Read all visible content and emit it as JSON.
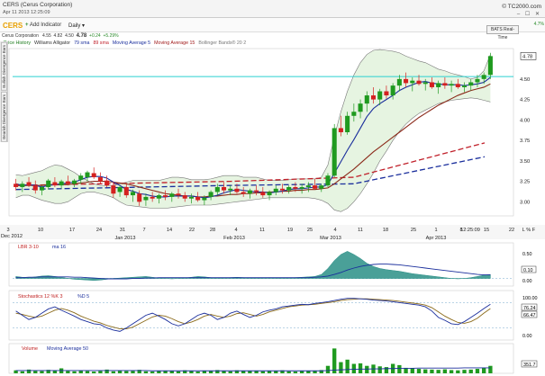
{
  "window": {
    "title": "CERS (Cerus Corporation)",
    "timestamp": "Apr 11 2013 12:25:09",
    "brand": "© TC2000.com",
    "controls": "– ☐ ✕"
  },
  "toolbar": {
    "symbol": "CERS",
    "add_indicator": "Add Indicator",
    "period": "Daily",
    "period_arrow": "▾"
  },
  "quote": {
    "name": "Cerus Corporation",
    "open": "4.55",
    "high": "4.82",
    "low": "4.50",
    "last": "4.78",
    "change": "+0.24",
    "pct": "+5.29%",
    "realtime": "BATS Real-Time",
    "side_pct": "4.7%"
  },
  "legend": [
    {
      "label": "Price History",
      "color": "#1a7a1a"
    },
    {
      "label": "Williams Alligator",
      "color": "#333333"
    },
    {
      "label": "79 sma",
      "color": "#1a2e9c"
    },
    {
      "label": "89 sma",
      "color": "#c0202a"
    },
    {
      "label": "Moving Average 5",
      "color": "#1a2e9c"
    },
    {
      "label": "Moving Average 15",
      "color": "#a01818"
    },
    {
      "label": "Bollinger Bands® 20 2",
      "color": "#777777"
    }
  ],
  "side_tabs": [
    "Bullish Divergence Bars",
    "Bearish Divergence Bars"
  ],
  "price_axis": {
    "ticks": [
      "4.50",
      "4.25",
      "4.00",
      "3.75",
      "3.50",
      "3.25",
      "3.00"
    ],
    "last_flag": "4.78"
  },
  "date_axis": {
    "corner": "Dec 2012",
    "day_ticks": [
      "3",
      "10",
      "17",
      "24",
      "31",
      "7",
      "14",
      "22",
      "28",
      "4",
      "11",
      "19",
      "25",
      "4",
      "11",
      "18",
      "25",
      "1",
      "8",
      "15",
      "22"
    ],
    "month_ticks": [
      "Jan 2013",
      "Feb 2013",
      "Mar 2013",
      "Apr 2013"
    ],
    "time_label": "12:25:09",
    "scale_label": "L % F"
  },
  "panels": {
    "lbr": {
      "label": "LBR 3-10",
      "ma": "ma 16",
      "ticks": [
        "0.50",
        "0.00"
      ],
      "flag": "0.10"
    },
    "stoch": {
      "label": "Stochastics 12 %K 3",
      "d": "%D 5",
      "ticks": [
        "100.00",
        "50.00",
        "0.00"
      ],
      "flags": [
        "76.24",
        "66.47"
      ]
    },
    "volume": {
      "label": "Volume",
      "ma": "Moving Average 50",
      "flag": "351.7"
    }
  },
  "chart_data": {
    "type": "candlestick",
    "ylim": [
      2.85,
      4.85
    ],
    "ref_line": 4.53,
    "ohlc": [
      [
        3.22,
        3.28,
        3.14,
        3.18
      ],
      [
        3.18,
        3.25,
        3.12,
        3.22
      ],
      [
        3.24,
        3.3,
        3.18,
        3.2
      ],
      [
        3.2,
        3.26,
        3.1,
        3.14
      ],
      [
        3.14,
        3.2,
        3.08,
        3.18
      ],
      [
        3.18,
        3.28,
        3.15,
        3.26
      ],
      [
        3.24,
        3.3,
        3.18,
        3.2
      ],
      [
        3.2,
        3.27,
        3.16,
        3.25
      ],
      [
        3.25,
        3.32,
        3.2,
        3.22
      ],
      [
        3.22,
        3.28,
        3.18,
        3.26
      ],
      [
        3.27,
        3.35,
        3.22,
        3.32
      ],
      [
        3.3,
        3.38,
        3.25,
        3.36
      ],
      [
        3.35,
        3.42,
        3.28,
        3.3
      ],
      [
        3.3,
        3.36,
        3.22,
        3.25
      ],
      [
        3.26,
        3.32,
        3.18,
        3.2
      ],
      [
        3.2,
        3.25,
        3.05,
        3.1
      ],
      [
        3.12,
        3.2,
        3.06,
        3.18
      ],
      [
        3.18,
        3.22,
        3.05,
        3.08
      ],
      [
        3.08,
        3.15,
        3.0,
        3.12
      ],
      [
        3.1,
        3.14,
        2.95,
        3.0
      ],
      [
        3.02,
        3.1,
        2.95,
        3.06
      ],
      [
        3.06,
        3.12,
        3.0,
        3.04
      ],
      [
        3.04,
        3.1,
        2.98,
        3.08
      ],
      [
        3.08,
        3.14,
        3.02,
        3.06
      ],
      [
        3.06,
        3.12,
        3.0,
        3.1
      ],
      [
        3.1,
        3.16,
        3.04,
        3.08
      ],
      [
        3.08,
        3.12,
        3.0,
        3.04
      ],
      [
        3.04,
        3.1,
        2.98,
        3.06
      ],
      [
        3.06,
        3.12,
        3.0,
        3.02
      ],
      [
        3.02,
        3.08,
        2.96,
        3.05
      ],
      [
        3.06,
        3.14,
        3.02,
        3.12
      ],
      [
        3.12,
        3.22,
        3.08,
        3.18
      ],
      [
        3.18,
        3.24,
        3.1,
        3.14
      ],
      [
        3.14,
        3.2,
        3.08,
        3.16
      ],
      [
        3.16,
        3.22,
        3.1,
        3.12
      ],
      [
        3.12,
        3.18,
        3.06,
        3.1
      ],
      [
        3.1,
        3.16,
        3.04,
        3.14
      ],
      [
        3.14,
        3.2,
        3.08,
        3.12
      ],
      [
        3.12,
        3.18,
        3.05,
        3.08
      ],
      [
        3.08,
        3.14,
        3.02,
        3.12
      ],
      [
        3.12,
        3.2,
        3.08,
        3.16
      ],
      [
        3.16,
        3.22,
        3.1,
        3.14
      ],
      [
        3.14,
        3.2,
        3.1,
        3.18
      ],
      [
        3.18,
        3.24,
        3.12,
        3.16
      ],
      [
        3.16,
        3.22,
        3.1,
        3.18
      ],
      [
        3.18,
        3.24,
        3.12,
        3.2
      ],
      [
        3.2,
        3.28,
        3.15,
        3.16
      ],
      [
        3.16,
        3.22,
        3.12,
        3.2
      ],
      [
        3.2,
        3.35,
        3.18,
        3.32
      ],
      [
        3.32,
        3.95,
        3.3,
        3.9
      ],
      [
        3.9,
        4.05,
        3.8,
        3.85
      ],
      [
        3.85,
        4.1,
        3.82,
        4.05
      ],
      [
        4.05,
        4.2,
        3.98,
        4.1
      ],
      [
        4.1,
        4.25,
        4.02,
        4.2
      ],
      [
        4.2,
        4.35,
        4.1,
        4.3
      ],
      [
        4.3,
        4.4,
        4.2,
        4.25
      ],
      [
        4.25,
        4.38,
        4.18,
        4.35
      ],
      [
        4.35,
        4.42,
        4.26,
        4.3
      ],
      [
        4.3,
        4.45,
        4.25,
        4.42
      ],
      [
        4.42,
        4.55,
        4.35,
        4.5
      ],
      [
        4.5,
        4.58,
        4.4,
        4.45
      ],
      [
        4.45,
        4.52,
        4.35,
        4.48
      ],
      [
        4.48,
        4.55,
        4.42,
        4.44
      ],
      [
        4.44,
        4.5,
        4.36,
        4.46
      ],
      [
        4.46,
        4.52,
        4.38,
        4.4
      ],
      [
        4.4,
        4.48,
        4.32,
        4.45
      ],
      [
        4.45,
        4.52,
        4.38,
        4.42
      ],
      [
        4.42,
        4.48,
        4.34,
        4.44
      ],
      [
        4.44,
        4.5,
        4.38,
        4.4
      ],
      [
        4.4,
        4.46,
        4.34,
        4.42
      ],
      [
        4.42,
        4.5,
        4.36,
        4.46
      ],
      [
        4.46,
        4.55,
        4.4,
        4.5
      ],
      [
        4.5,
        4.58,
        4.44,
        4.55
      ],
      [
        4.55,
        4.82,
        4.5,
        4.78
      ]
    ],
    "ma5": [
      3.22,
      3.2,
      3.21,
      3.2,
      3.18,
      3.2,
      3.21,
      3.22,
      3.23,
      3.24,
      3.27,
      3.3,
      3.31,
      3.31,
      3.29,
      3.24,
      3.2,
      3.15,
      3.13,
      3.1,
      3.09,
      3.07,
      3.06,
      3.06,
      3.07,
      3.07,
      3.07,
      3.07,
      3.06,
      3.05,
      3.06,
      3.08,
      3.11,
      3.13,
      3.15,
      3.14,
      3.13,
      3.12,
      3.12,
      3.11,
      3.12,
      3.13,
      3.15,
      3.16,
      3.16,
      3.17,
      3.18,
      3.18,
      3.21,
      3.35,
      3.49,
      3.63,
      3.76,
      3.9,
      4.04,
      4.14,
      4.2,
      4.25,
      4.3,
      4.36,
      4.4,
      4.43,
      4.46,
      4.47,
      4.45,
      4.44,
      4.43,
      4.43,
      4.43,
      4.42,
      4.43,
      4.44,
      4.46,
      4.52
    ],
    "ma15": [
      3.2,
      3.2,
      3.2,
      3.2,
      3.2,
      3.21,
      3.21,
      3.21,
      3.21,
      3.22,
      3.23,
      3.24,
      3.25,
      3.25,
      3.25,
      3.24,
      3.23,
      3.22,
      3.2,
      3.18,
      3.16,
      3.14,
      3.12,
      3.1,
      3.09,
      3.08,
      3.07,
      3.07,
      3.06,
      3.06,
      3.07,
      3.07,
      3.08,
      3.09,
      3.09,
      3.1,
      3.1,
      3.11,
      3.11,
      3.12,
      3.12,
      3.13,
      3.13,
      3.14,
      3.14,
      3.15,
      3.15,
      3.16,
      3.17,
      3.22,
      3.28,
      3.34,
      3.4,
      3.47,
      3.54,
      3.61,
      3.67,
      3.73,
      3.79,
      3.85,
      3.91,
      3.97,
      4.03,
      4.08,
      4.13,
      4.18,
      4.22,
      4.26,
      4.3,
      4.33,
      4.36,
      4.38,
      4.4,
      4.44
    ],
    "sma79": [
      3.15,
      3.2,
      3.22,
      3.55
    ],
    "sma89": [
      3.2,
      3.25,
      3.3,
      3.72
    ],
    "bb_upper": [
      3.33,
      3.32,
      3.34,
      3.36,
      3.38,
      3.42,
      3.45,
      3.44,
      3.4,
      3.36,
      3.3,
      3.26,
      3.22,
      3.2,
      3.2,
      3.2,
      3.22,
      3.24,
      3.26,
      3.26,
      3.26,
      3.26,
      3.26,
      3.28,
      3.3,
      3.3,
      3.29,
      3.27,
      3.27,
      3.27,
      3.28,
      3.3,
      3.32,
      3.32,
      3.32,
      3.3,
      3.3,
      3.3,
      3.28,
      3.26,
      3.26,
      3.26,
      3.27,
      3.28,
      3.28,
      3.28,
      3.28,
      3.3,
      3.45,
      3.8,
      4.1,
      4.35,
      4.55,
      4.7,
      4.8,
      4.85,
      4.86,
      4.85,
      4.84,
      4.82,
      4.78,
      4.75,
      4.72,
      4.7,
      4.66,
      4.62,
      4.6,
      4.57,
      4.55,
      4.53,
      4.5,
      4.52,
      4.6,
      4.8
    ],
    "bb_lower": [
      3.05,
      3.08,
      3.08,
      3.05,
      3.02,
      3.0,
      2.98,
      2.98,
      3.0,
      3.05,
      3.1,
      3.12,
      3.12,
      3.1,
      3.08,
      3.05,
      3.0,
      2.96,
      2.95,
      2.94,
      2.93,
      2.92,
      2.92,
      2.92,
      2.93,
      2.94,
      2.95,
      2.96,
      2.96,
      2.96,
      2.96,
      2.97,
      2.98,
      2.99,
      3.0,
      3.01,
      3.02,
      3.03,
      3.04,
      3.05,
      3.05,
      3.05,
      3.05,
      3.05,
      3.05,
      3.05,
      3.04,
      3.02,
      2.98,
      2.9,
      2.88,
      2.92,
      3.0,
      3.1,
      3.22,
      3.35,
      3.5,
      3.62,
      3.75,
      3.86,
      3.95,
      4.02,
      4.08,
      4.12,
      4.16,
      4.2,
      4.22,
      4.24,
      4.25,
      4.26,
      4.27,
      4.26,
      4.24,
      4.22
    ],
    "lbr": [
      0.05,
      0.03,
      0.02,
      0.04,
      0.06,
      0.07,
      0.05,
      0.03,
      0.0,
      -0.02,
      -0.03,
      -0.04,
      -0.05,
      -0.04,
      -0.02,
      0.0,
      0.01,
      0.02,
      0.03,
      0.04,
      0.05,
      0.03,
      0.01,
      0.0,
      -0.01,
      0.0,
      0.01,
      0.03,
      0.05,
      0.04,
      0.02,
      0.0,
      0.01,
      0.02,
      0.03,
      0.02,
      0.01,
      0.0,
      0.01,
      0.02,
      0.01,
      0.0,
      0.01,
      0.02,
      0.03,
      0.04,
      0.05,
      0.1,
      0.25,
      0.45,
      0.6,
      0.68,
      0.6,
      0.5,
      0.38,
      0.3,
      0.25,
      0.22,
      0.2,
      0.18,
      0.15,
      0.12,
      0.1,
      0.08,
      0.06,
      0.04,
      0.02,
      0.0,
      -0.01,
      0.0,
      0.02,
      0.05,
      0.08,
      0.1
    ],
    "lbr_ma": [
      0.02,
      0.02,
      0.03,
      0.03,
      0.04,
      0.04,
      0.04,
      0.04,
      0.04,
      0.03,
      0.03,
      0.02,
      0.01,
      0.0,
      -0.01,
      -0.01,
      -0.01,
      -0.01,
      0.0,
      0.0,
      0.01,
      0.01,
      0.02,
      0.02,
      0.02,
      0.02,
      0.02,
      0.02,
      0.02,
      0.02,
      0.02,
      0.02,
      0.02,
      0.02,
      0.02,
      0.02,
      0.02,
      0.02,
      0.02,
      0.02,
      0.02,
      0.02,
      0.02,
      0.02,
      0.02,
      0.02,
      0.03,
      0.04,
      0.06,
      0.1,
      0.15,
      0.21,
      0.26,
      0.3,
      0.33,
      0.35,
      0.36,
      0.36,
      0.35,
      0.34,
      0.32,
      0.3,
      0.28,
      0.26,
      0.24,
      0.22,
      0.2,
      0.18,
      0.16,
      0.14,
      0.12,
      0.1,
      0.09,
      0.09
    ],
    "stoch_k": [
      60,
      50,
      40,
      45,
      55,
      65,
      70,
      62,
      55,
      48,
      40,
      35,
      30,
      28,
      20,
      15,
      12,
      20,
      30,
      40,
      50,
      55,
      48,
      40,
      30,
      25,
      30,
      40,
      50,
      55,
      50,
      40,
      45,
      55,
      60,
      52,
      45,
      50,
      58,
      62,
      65,
      70,
      72,
      74,
      76,
      75,
      78,
      80,
      82,
      85,
      88,
      90,
      90,
      89,
      88,
      86,
      85,
      84,
      82,
      80,
      78,
      76,
      74,
      70,
      60,
      45,
      38,
      30,
      28,
      35,
      45,
      55,
      66,
      76
    ],
    "stoch_d": [
      55,
      52,
      48,
      45,
      48,
      55,
      62,
      66,
      62,
      56,
      48,
      42,
      36,
      32,
      26,
      22,
      18,
      18,
      22,
      30,
      38,
      46,
      50,
      48,
      42,
      35,
      30,
      34,
      40,
      48,
      52,
      48,
      45,
      48,
      54,
      56,
      52,
      48,
      52,
      58,
      62,
      66,
      70,
      72,
      74,
      75,
      76,
      78,
      80,
      82,
      85,
      87,
      88,
      89,
      89,
      88,
      87,
      86,
      85,
      83,
      81,
      79,
      77,
      74,
      68,
      58,
      48,
      40,
      33,
      31,
      35,
      43,
      55,
      66
    ],
    "volume": [
      12,
      8,
      15,
      10,
      9,
      14,
      11,
      20,
      10,
      8,
      12,
      9,
      7,
      10,
      15,
      8,
      11,
      9,
      10,
      14,
      8,
      7,
      9,
      11,
      10,
      8,
      12,
      9,
      7,
      11,
      10,
      13,
      9,
      8,
      12,
      10,
      9,
      11,
      8,
      10,
      9,
      12,
      8,
      7,
      10,
      9,
      11,
      13,
      30,
      100,
      45,
      55,
      38,
      40,
      30,
      35,
      28,
      25,
      38,
      33,
      22,
      20,
      18,
      16,
      15,
      14,
      16,
      13,
      12,
      14,
      15,
      18,
      22,
      30
    ],
    "vol_ma": [
      11,
      11,
      11,
      11,
      11,
      11,
      11,
      11,
      11,
      11,
      11,
      11,
      11,
      11,
      11,
      11,
      11,
      11,
      11,
      11,
      11,
      10,
      10,
      10,
      10,
      10,
      10,
      10,
      10,
      10,
      10,
      10,
      10,
      10,
      10,
      10,
      10,
      10,
      10,
      10,
      10,
      10,
      10,
      10,
      10,
      10,
      10,
      10,
      11,
      13,
      14,
      15,
      16,
      17,
      17,
      18,
      18,
      19,
      19,
      20,
      20,
      20,
      21,
      21,
      21,
      21,
      21,
      21,
      21,
      22,
      22,
      22,
      22,
      22
    ]
  },
  "colors": {
    "up": "#1f9a1f",
    "down": "#d42020",
    "ma5": "#1a2e9c",
    "ma15": "#8b2a1a",
    "sma79": "#1a2e9c",
    "sma89": "#c0202a",
    "bb_fill": "#e6f4e1",
    "bb_line": "#777777",
    "ref": "#2ad0d0",
    "lbr": "#2a8f86",
    "lbr_ma": "#1a2e9c",
    "stoch_k": "#1a2e9c",
    "stoch_d": "#8b6a1a",
    "vol": "#1f9a1f"
  }
}
